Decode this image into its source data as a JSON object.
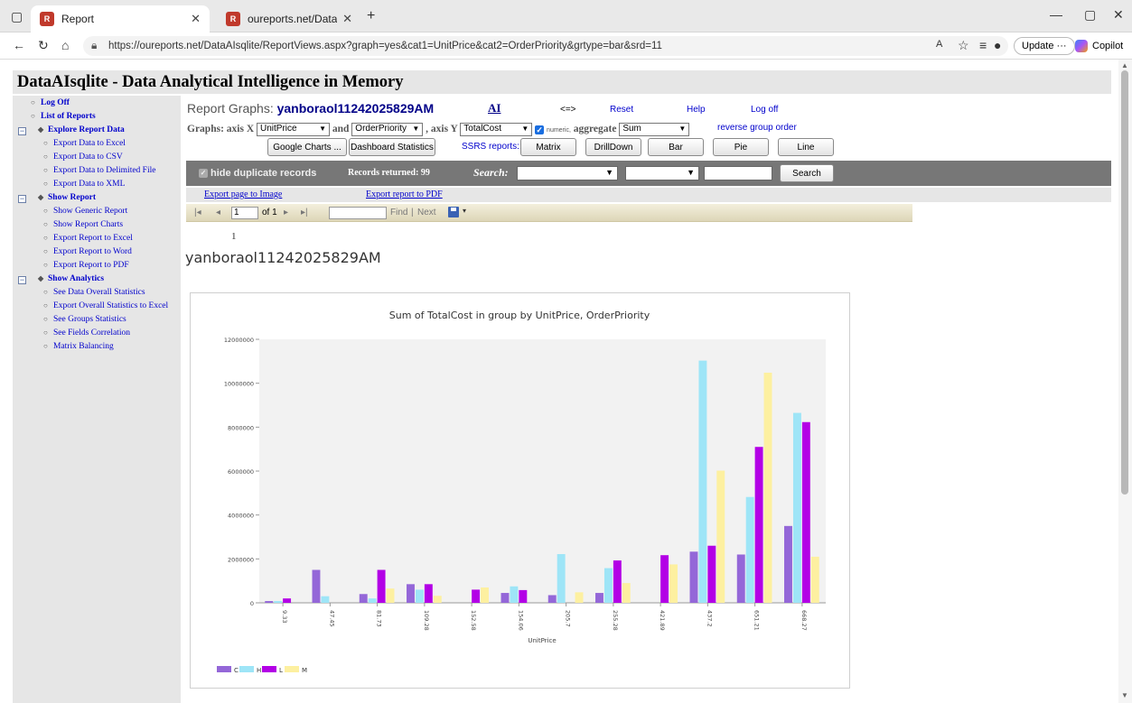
{
  "browser": {
    "tabs": [
      {
        "title": "Report",
        "active": true
      },
      {
        "title": "oureports.net/DataAIsqlite/DataA",
        "active": false
      }
    ],
    "url": "https://oureports.net/DataAIsqlite/ReportViews.aspx?graph=yes&cat1=UnitPrice&cat2=OrderPriority&grtype=bar&srd=11",
    "update_label": "Update",
    "copilot_label": "Copilot"
  },
  "app": {
    "title": "DataAIsqlite - Data Analytical Intelligence in Memory"
  },
  "sidebar": {
    "items": [
      {
        "label": "Log Off",
        "bold": true
      },
      {
        "label": "List of Reports",
        "bold": true
      },
      {
        "label": "Explore Report Data",
        "bold": true
      },
      {
        "label": "Export Data to Excel",
        "bold": false
      },
      {
        "label": "Export Data to CSV",
        "bold": false
      },
      {
        "label": "Export Data to Delimited File",
        "bold": false
      },
      {
        "label": "Export Data to XML",
        "bold": false
      },
      {
        "label": "Show Report",
        "bold": true
      },
      {
        "label": "Show Generic Report",
        "bold": false
      },
      {
        "label": "Show Report Charts",
        "bold": false
      },
      {
        "label": "Export Report to Excel",
        "bold": false
      },
      {
        "label": "Export Report to Word",
        "bold": false
      },
      {
        "label": "Export Report to PDF",
        "bold": false
      },
      {
        "label": "Show Analytics",
        "bold": true
      },
      {
        "label": "See Data Overall Statistics",
        "bold": false
      },
      {
        "label": "Export Overall Statistics to Excel",
        "bold": false
      },
      {
        "label": "See Groups Statistics",
        "bold": false
      },
      {
        "label": "See Fields Correlation",
        "bold": false
      },
      {
        "label": "Matrix Balancing",
        "bold": false
      }
    ]
  },
  "header": {
    "prefix": "Report Graphs: ",
    "report_name": "yanboraol11242025829AM",
    "ai_link": "AI",
    "arrow": "<=>",
    "reset": "Reset",
    "help": "Help",
    "logoff": "Log off"
  },
  "graphs": {
    "label_graphs": "Graphs: axis X",
    "x_field": "UnitPrice",
    "label_and": "and",
    "group_field": "OrderPriority",
    "label_axis_y": ", axis Y",
    "y_field": "TotalCost",
    "numeric_label": "numeric,",
    "label_aggregate": "aggregate",
    "aggregate": "Sum",
    "reverse_link": "reverse group order"
  },
  "buttons": {
    "google_charts": "Google Charts ...",
    "dashboard": "Dashboard Statistics",
    "ssrs_label": "SSRS reports:",
    "matrix": "Matrix",
    "drilldown": "DrillDown",
    "bar": "Bar",
    "pie": "Pie",
    "line": "Line"
  },
  "filter_bar": {
    "hide_duplicates": "hide duplicate records",
    "records": "Records returned: 99",
    "search_label": "Search:",
    "search_button": "Search"
  },
  "export": {
    "image": "Export page to Image",
    "pdf": "Export report to PDF"
  },
  "viewer": {
    "page_value": "1",
    "of_pages": "of 1",
    "find": "Find",
    "separator": "|",
    "next": "Next"
  },
  "report": {
    "page_number": "1",
    "heading": "yanboraol11242025829AM"
  },
  "chart_data": {
    "type": "bar",
    "title": "Sum of TotalCost in group by UnitPrice, OrderPriority",
    "xlabel": "UnitPrice",
    "ylabel": "",
    "ylim": [
      0,
      12000000
    ],
    "yticks": [
      0,
      2000000,
      4000000,
      6000000,
      8000000,
      10000000,
      12000000
    ],
    "categories": [
      "9.33",
      "47.45",
      "81.73",
      "109.28",
      "152.58",
      "154.06",
      "205.7",
      "255.28",
      "421.89",
      "437.2",
      "651.21",
      "668.27"
    ],
    "series": [
      {
        "name": "C",
        "color": "#9467d8",
        "values": [
          80000,
          1500000,
          400000,
          850000,
          0,
          450000,
          350000,
          450000,
          0,
          2330000,
          2200000,
          3500000
        ]
      },
      {
        "name": "H",
        "color": "#9ee5f7",
        "values": [
          80000,
          300000,
          200000,
          600000,
          0,
          750000,
          2220000,
          1580000,
          0,
          11030000,
          4820000,
          8650000
        ]
      },
      {
        "name": "L",
        "color": "#b300e6",
        "values": [
          200000,
          0,
          1500000,
          850000,
          600000,
          580000,
          0,
          1930000,
          2170000,
          2600000,
          7100000,
          8230000
        ]
      },
      {
        "name": "M",
        "color": "#fdf0a0",
        "values": [
          0,
          0,
          650000,
          320000,
          700000,
          0,
          480000,
          900000,
          1750000,
          6020000,
          10480000,
          2100000
        ]
      }
    ],
    "legend": "bottom-left",
    "grid": false
  }
}
